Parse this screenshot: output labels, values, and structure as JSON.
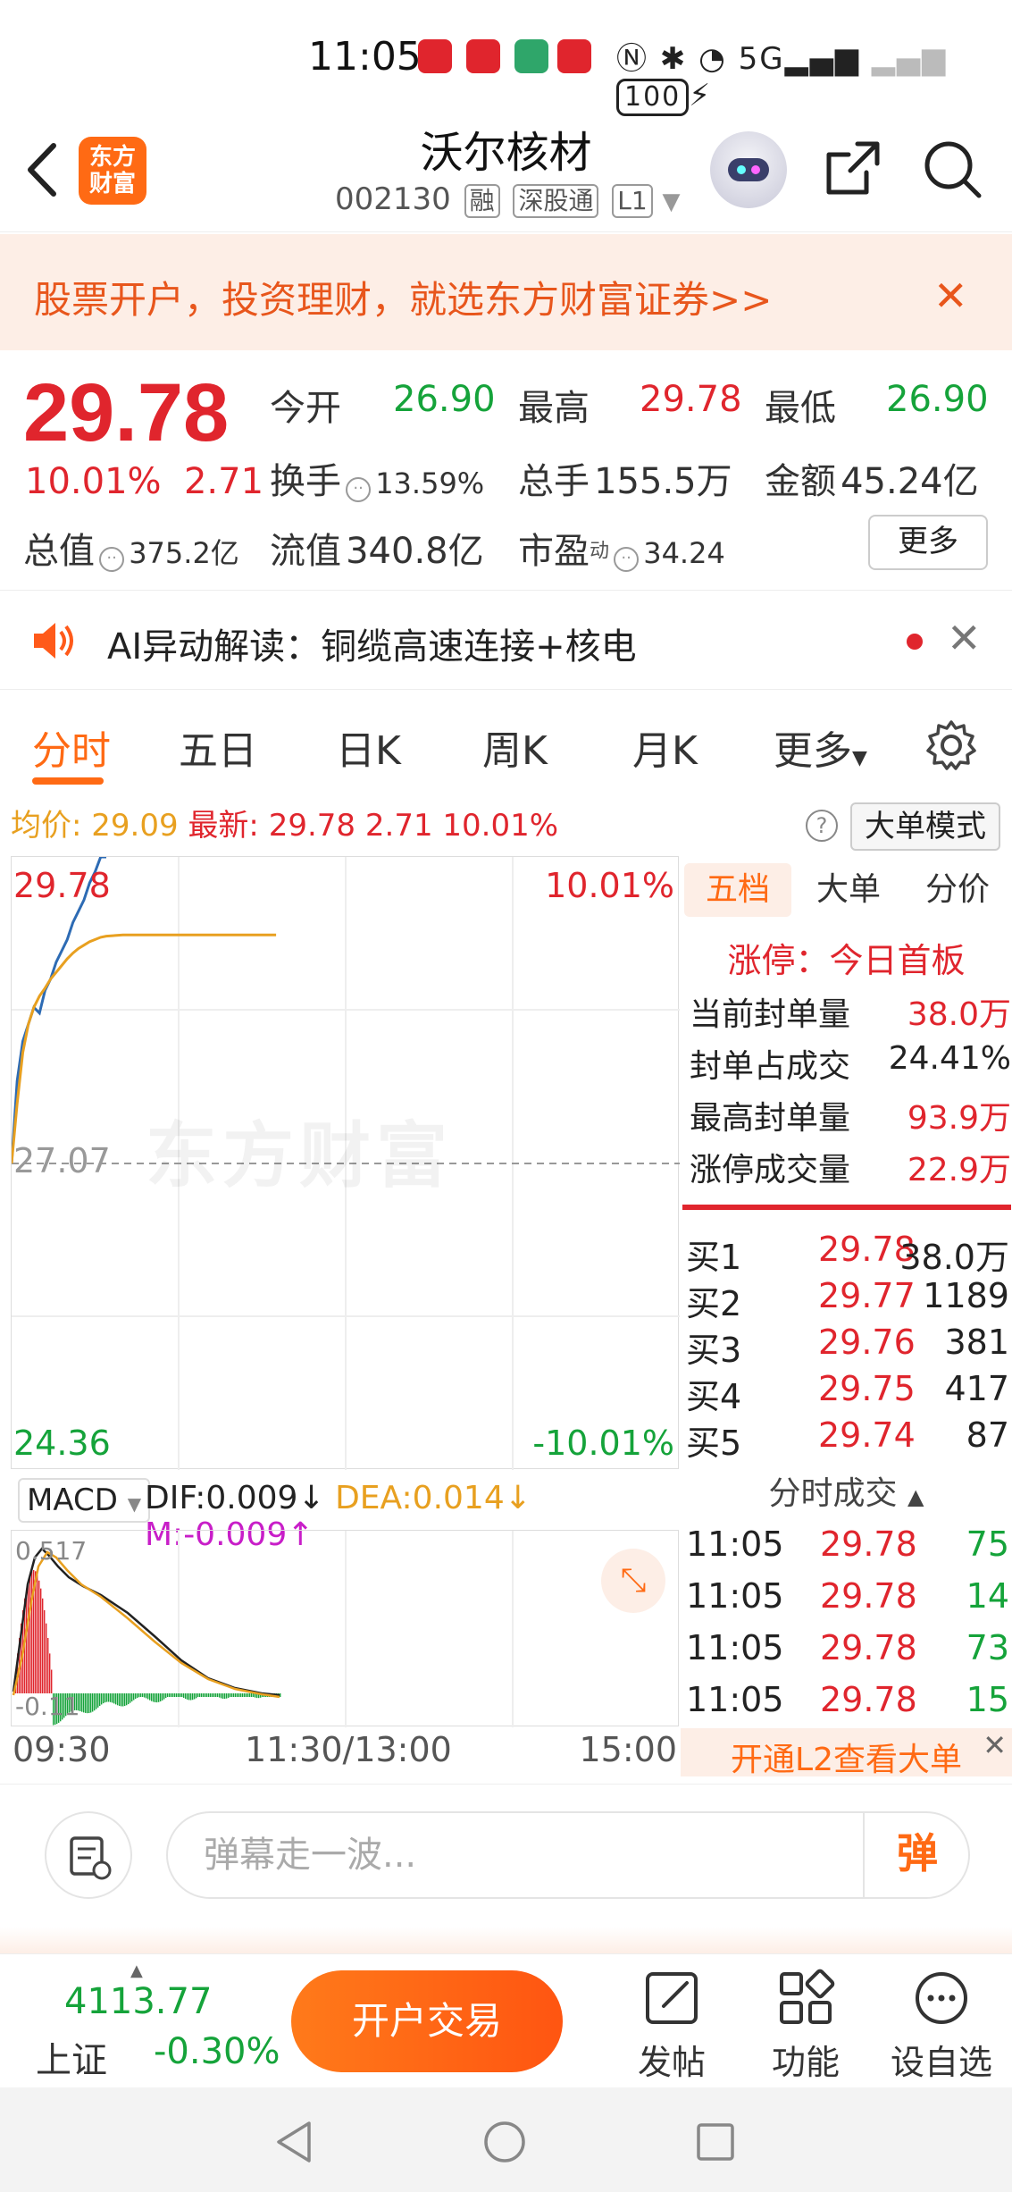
{
  "status_bar": {
    "time": "11:05",
    "network": "5G",
    "battery": "100"
  },
  "header": {
    "stock_name": "沃尔核材",
    "stock_code": "002130",
    "tags": [
      "融",
      "深股通",
      "L1"
    ],
    "app_logo": "东方\n财富"
  },
  "promo": {
    "text": "股票开户，投资理财，就选东方财富证券>>"
  },
  "quote": {
    "price": "29.78",
    "pct": "10.01%",
    "change": "2.71",
    "open_label": "今开",
    "open": "26.90",
    "high_label": "最高",
    "high": "29.78",
    "low_label": "最低",
    "low": "26.90",
    "turnover_label": "换手",
    "turnover": "13.59%",
    "volume_label": "总手",
    "volume": "155.5万",
    "amount_label": "金额",
    "amount": "45.24亿",
    "mktcap_label": "总值",
    "mktcap": "375.2亿",
    "float_label": "流值",
    "float": "340.8亿",
    "pe_label": "市盈",
    "pe_sup": "动",
    "pe": "34.24",
    "more": "更多"
  },
  "ai_bar": {
    "text": "AI异动解读：铜缆高速连接+核电"
  },
  "tabs": [
    "分时",
    "五日",
    "日K",
    "周K",
    "月K",
    "更多"
  ],
  "avg_line": {
    "avg_label": "均价:",
    "avg": "29.09",
    "latest_label": "最新:",
    "latest": "29.78",
    "change": "2.71",
    "pct": "10.01%",
    "big_order_mode": "大单模式"
  },
  "chart": {
    "high_price": "29.78",
    "high_pct": "10.01%",
    "prev_close": "27.07",
    "low_price": "24.36",
    "low_pct": "-10.01%",
    "watermark": "东方财富",
    "time_start": "09:30",
    "time_mid": "11:30/13:00",
    "time_end": "15:00"
  },
  "chart_data": {
    "type": "line",
    "series": [
      {
        "name": "最新",
        "color": "#2d6bb4",
        "x": [
          "09:30",
          "09:32",
          "09:34",
          "09:36",
          "09:38",
          "09:40",
          "09:42",
          "09:44",
          "09:46",
          "09:48",
          "09:50",
          "09:52",
          "09:54",
          "09:56",
          "09:58",
          "10:00",
          "10:02",
          "10:04"
        ],
        "values": [
          27.07,
          27.8,
          28.15,
          28.3,
          28.45,
          28.4,
          28.6,
          28.7,
          28.85,
          28.95,
          29.05,
          29.2,
          29.3,
          29.4,
          29.55,
          29.65,
          29.78,
          29.78
        ]
      },
      {
        "name": "均价",
        "color": "#e8a020",
        "x": [
          "09:30",
          "09:32",
          "09:34",
          "09:36",
          "09:38",
          "09:40",
          "09:42",
          "09:44",
          "09:46",
          "09:48",
          "09:50",
          "09:52",
          "09:54",
          "09:56",
          "09:58",
          "10:00",
          "10:02",
          "10:04",
          "10:10",
          "10:20",
          "10:30",
          "10:40",
          "10:50",
          "11:00",
          "11:05"
        ],
        "values": [
          27.07,
          27.6,
          28.05,
          28.3,
          28.45,
          28.55,
          28.62,
          28.7,
          28.76,
          28.82,
          28.88,
          28.93,
          28.97,
          29.0,
          29.03,
          29.05,
          29.07,
          29.08,
          29.09,
          29.09,
          29.09,
          29.09,
          29.09,
          29.09,
          29.09
        ]
      }
    ],
    "ylim": [
      24.36,
      29.78
    ],
    "prev_close": 27.07
  },
  "macd": {
    "indicator": "MACD",
    "dif": "DIF:0.009",
    "dea": "DEA:0.014",
    "m": "M:-0.009",
    "max": "0.517",
    "min": "-0.11"
  },
  "right_panel": {
    "tabs": [
      "五档",
      "大单",
      "分价"
    ],
    "limit_title": "涨停：今日首板",
    "seal": [
      {
        "label": "当前封单量",
        "value": "38.0万"
      },
      {
        "label": "封单占成交",
        "value": "24.41%"
      },
      {
        "label": "最高封单量",
        "value": "93.9万"
      },
      {
        "label": "涨停成交量",
        "value": "22.9万"
      }
    ],
    "bids": [
      {
        "label": "买1",
        "price": "29.78",
        "vol": "38.0万"
      },
      {
        "label": "买2",
        "price": "29.77",
        "vol": "1189"
      },
      {
        "label": "买3",
        "price": "29.76",
        "vol": "381"
      },
      {
        "label": "买4",
        "price": "29.75",
        "vol": "417"
      },
      {
        "label": "买5",
        "price": "29.74",
        "vol": "87"
      }
    ],
    "ticks_header": "分时成交",
    "ticks": [
      {
        "time": "11:05",
        "price": "29.78",
        "vol": "75"
      },
      {
        "time": "11:05",
        "price": "29.78",
        "vol": "14"
      },
      {
        "time": "11:05",
        "price": "29.78",
        "vol": "73"
      },
      {
        "time": "11:05",
        "price": "29.78",
        "vol": "15"
      }
    ],
    "l2_text": "开通L2查看大单"
  },
  "comment": {
    "placeholder": "弹幕走一波...",
    "danmu": "弹"
  },
  "bottom_bar": {
    "index_value": "4113.77",
    "index_name": "上证",
    "index_pct": "-0.30%",
    "trade_button": "开户交易",
    "nav": [
      "发帖",
      "功能",
      "设自选"
    ]
  }
}
